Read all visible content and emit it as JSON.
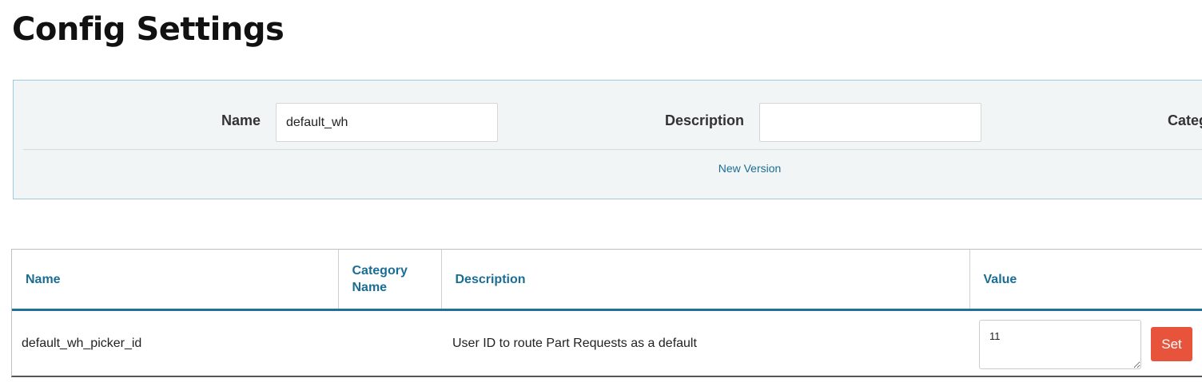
{
  "page": {
    "title": "Config Settings"
  },
  "filter": {
    "name_label": "Name",
    "name_value": "default_wh",
    "description_label": "Description",
    "description_value": "",
    "category_label": "Categ",
    "new_version_link": "New Version"
  },
  "table": {
    "headers": {
      "name": "Name",
      "category_line1": "Category",
      "category_line2": "Name",
      "description": "Description",
      "value": "Value"
    },
    "rows": [
      {
        "name": "default_wh_picker_id",
        "category": "",
        "description": "User ID to route Part Requests as a default",
        "value": "11",
        "set_label": "Set"
      }
    ]
  },
  "colors": {
    "accent": "#1b6d94",
    "set_button": "#e8533c",
    "panel_bg": "#f1f5f6",
    "panel_border": "#9fc9dc"
  }
}
